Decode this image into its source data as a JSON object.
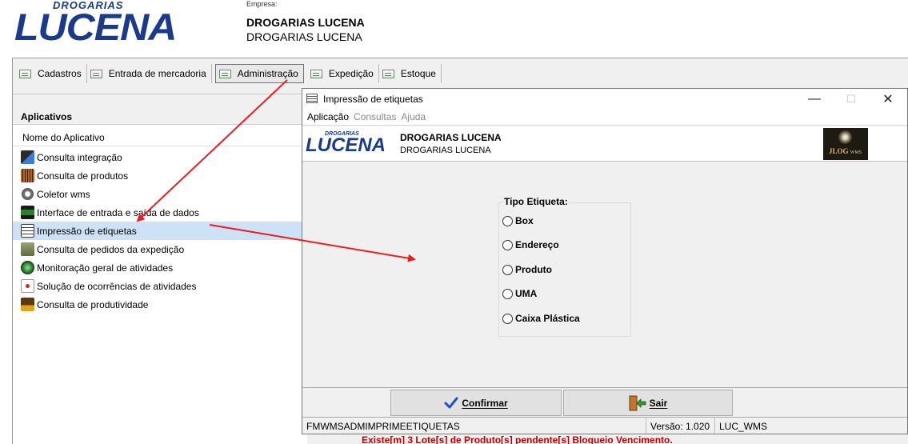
{
  "header": {
    "logo_top": "DROGARIAS",
    "logo_main": "LUCENA",
    "company_caption": "Empresa:",
    "company_name": "DROGARIAS LUCENA",
    "company_sub": "DROGARIAS LUCENA"
  },
  "tabs": [
    {
      "label": "Cadastros",
      "icon": "module-icon"
    },
    {
      "label": "Entrada de mercadoria",
      "icon": "module-icon"
    },
    {
      "label": "Administração",
      "icon": "module-icon",
      "active": true
    },
    {
      "label": "Expedição",
      "icon": "module-icon"
    },
    {
      "label": "Estoque",
      "icon": "module-icon"
    }
  ],
  "apps_panel": {
    "title": "Aplicativos",
    "column_header": "Nome do Aplicativo",
    "items": [
      {
        "label": "Consulta integração",
        "icon": "integration-icon",
        "color": "#2b2b2b"
      },
      {
        "label": "Consulta de produtos",
        "icon": "barcode-icon",
        "color": "#b5651d"
      },
      {
        "label": "Coletor wms",
        "icon": "gears-icon",
        "color": "#808080"
      },
      {
        "label": "Interface de entrada e saída de dados",
        "icon": "interface-icon",
        "color": "#2e7d32"
      },
      {
        "label": "Impressão de etiquetas",
        "icon": "labels-icon",
        "color": "#3a3a3a",
        "selected": true
      },
      {
        "label": "Consulta de pedidos da expedição",
        "icon": "orders-icon",
        "color": "#5b6b3b"
      },
      {
        "label": "Monitoração geral de atividades",
        "icon": "radar-icon",
        "color": "#1b5e20"
      },
      {
        "label": "Solução de ocorrências de atividades",
        "icon": "first-aid-icon",
        "color": "#d32f2f"
      },
      {
        "label": "Consulta de produtividade",
        "icon": "productivity-chart-icon",
        "color": "#e0a020"
      }
    ]
  },
  "dialog": {
    "title": "Impressão de etiquetas",
    "menu": [
      {
        "label": "Aplicação",
        "enabled": true
      },
      {
        "label": "Consultas",
        "enabled": false
      },
      {
        "label": "Ajuda",
        "enabled": false
      }
    ],
    "window_controls": {
      "minimize": "—",
      "maximize": "☐",
      "close": "✕"
    },
    "logo_top": "DROGARIAS",
    "logo_main": "LUCENA",
    "company_name": "DROGARIAS LUCENA",
    "company_sub": "DROGARIAS LUCENA",
    "partner_logo": {
      "name": "JLOG",
      "suffix": "WMS"
    },
    "label_type_group": {
      "title": "Tipo Etiqueta:",
      "options": [
        "Box",
        "Endereço",
        "Produto",
        "UMA",
        "Caixa Plástica"
      ],
      "selected": null
    },
    "buttons": {
      "confirm": "Confirmar",
      "exit": "Sair"
    },
    "status": {
      "form_name": "FMWMSADMIMPRIMEETIQUETAS",
      "version": "Versão: 1.020",
      "system": "LUC_WMS"
    }
  },
  "warning": "Existe[m] 3 Lote[s] de Produto[s] pendente[s] Bloqueio Vencimento.",
  "colors": {
    "accent": "#1a3a8a",
    "selection": "#cde2f6",
    "warning": "#c00000",
    "annotation_arrow": "#ee1c1c"
  }
}
